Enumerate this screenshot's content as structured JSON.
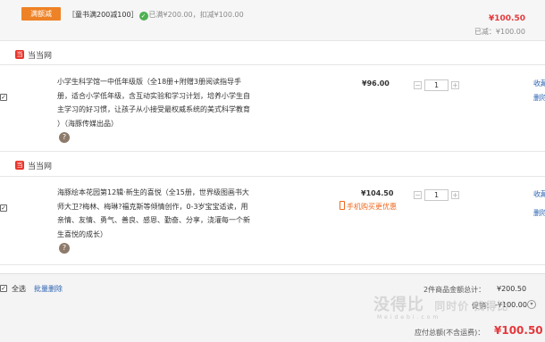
{
  "promo": {
    "tag": "满额减",
    "text": "［童书满200减100］",
    "done": "已满¥200.00，扣减¥100.00",
    "total": "¥100.50",
    "saved": "已减：¥100.00"
  },
  "stores": [
    {
      "name": "当当网",
      "logo_char": "当",
      "item": {
        "title": "小学生科学馆一中低年级版（全18册+附赠3册阅读指导手册，适合小学低年级，含互动实验和学习计划，培养小学生自主学习的好习惯，让孩子从小接受最权威系统的美式科学教育 ）（海豚传媒出品）",
        "price": "¥96.00",
        "qty": "1",
        "action1": "收藏",
        "action2": "删除"
      }
    },
    {
      "name": "当当网",
      "logo_char": "当",
      "item": {
        "title": "海豚绘本花园第12辑·新生的喜悦（全15册，世界级图画书大师大卫?梅林、梅琳?福克斯等倾情创作，0-3岁宝宝适读，用亲情、友情、勇气、善良、感恩、勤奋、分享，浇灌每一个新生喜悦的成长）",
        "price": "¥104.50",
        "mobile_promo": "手机购买更优惠",
        "qty": "1",
        "action1": "收藏",
        "action2": "删除"
      }
    }
  ],
  "footer": {
    "select_all": "全选",
    "batch_delete": "批量删除",
    "count_label": "2件商品金额总计：",
    "count_value": "¥200.50",
    "discount_label": "促销：",
    "discount_value": "-¥100.00",
    "pay_label": "应付总额(不含运费)：",
    "pay_value": "¥100.50"
  },
  "watermark": {
    "main": "没得比",
    "site": "Meidebi.com",
    "slogan": "同时价 找得比",
    "sub": "MEIDEBI"
  },
  "icons": {
    "check": "check-icon",
    "store": "store-logo-icon",
    "gift": "gift-icon",
    "phone": "phone-icon",
    "arrow": "chevron-down-icon"
  },
  "colors": {
    "promo_tag": "#ee8226",
    "price_red": "#e4393c",
    "link_blue": "#2d64b3",
    "mobile_orange": "#ee6a1f",
    "store_logo": "#e7362c"
  }
}
